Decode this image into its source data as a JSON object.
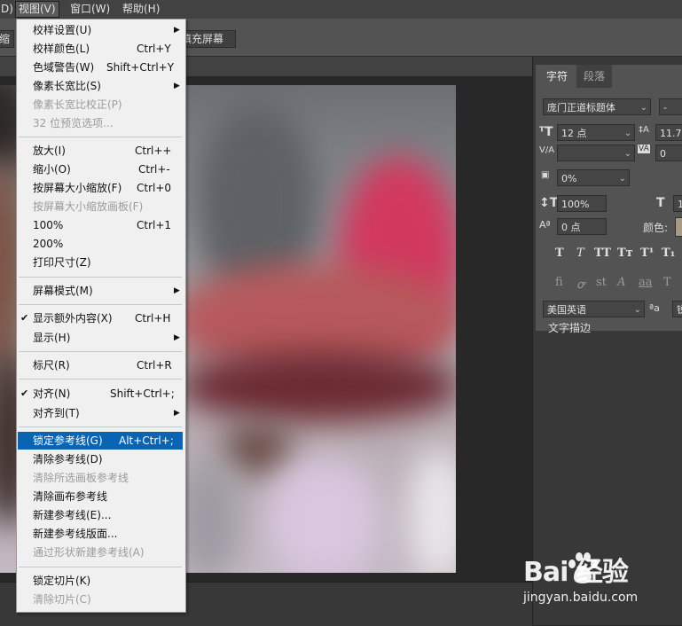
{
  "menubar": {
    "items": [
      {
        "label": "D)"
      },
      {
        "label": "视图(V)"
      },
      {
        "label": "窗口(W)"
      },
      {
        "label": "帮助(H)"
      }
    ]
  },
  "options_bar": {
    "partial_label": "缩",
    "fill_screen": "填充屏幕"
  },
  "view_menu": {
    "items": [
      {
        "label": "校样设置(U)",
        "shortcut": "",
        "submenu": true
      },
      {
        "label": "校样颜色(L)",
        "shortcut": "Ctrl+Y"
      },
      {
        "label": "色域警告(W)",
        "shortcut": "Shift+Ctrl+Y"
      },
      {
        "label": "像素长宽比(S)",
        "shortcut": "",
        "submenu": true
      },
      {
        "label": "像素长宽比校正(P)",
        "shortcut": "",
        "disabled": true
      },
      {
        "label": "32 位预览选项...",
        "shortcut": "",
        "disabled": true
      },
      {
        "label": "放大(I)",
        "shortcut": "Ctrl++"
      },
      {
        "label": "缩小(O)",
        "shortcut": "Ctrl+-"
      },
      {
        "label": "按屏幕大小缩放(F)",
        "shortcut": "Ctrl+0"
      },
      {
        "label": "按屏幕大小缩放画板(F)",
        "shortcut": "",
        "disabled": true
      },
      {
        "label": "100%",
        "shortcut": "Ctrl+1"
      },
      {
        "label": "200%",
        "shortcut": ""
      },
      {
        "label": "打印尺寸(Z)",
        "shortcut": ""
      },
      {
        "label": "屏幕模式(M)",
        "shortcut": "",
        "submenu": true
      },
      {
        "label": "显示额外内容(X)",
        "shortcut": "Ctrl+H",
        "checked": true
      },
      {
        "label": "显示(H)",
        "shortcut": "",
        "submenu": true
      },
      {
        "label": "标尺(R)",
        "shortcut": "Ctrl+R"
      },
      {
        "label": "对齐(N)",
        "shortcut": "Shift+Ctrl+;",
        "checked": true
      },
      {
        "label": "对齐到(T)",
        "shortcut": "",
        "submenu": true
      },
      {
        "label": "锁定参考线(G)",
        "shortcut": "Alt+Ctrl+;",
        "highlighted": true
      },
      {
        "label": "清除参考线(D)",
        "shortcut": ""
      },
      {
        "label": "清除所选画板参考线",
        "shortcut": "",
        "disabled": true
      },
      {
        "label": "清除画布参考线",
        "shortcut": ""
      },
      {
        "label": "新建参考线(E)...",
        "shortcut": ""
      },
      {
        "label": "新建参考线版面...",
        "shortcut": ""
      },
      {
        "label": "通过形状新建参考线(A)",
        "shortcut": "",
        "disabled": true
      },
      {
        "label": "锁定切片(K)",
        "shortcut": ""
      },
      {
        "label": "清除切片(C)",
        "shortcut": "",
        "disabled": true
      }
    ]
  },
  "character_panel": {
    "tabs": [
      {
        "label": "字符"
      },
      {
        "label": "段落"
      }
    ],
    "font_family": "庞门正道标题体",
    "font_style": "-",
    "font_size": "12 点",
    "leading": "11.72",
    "kerning": "",
    "tracking": "0",
    "tsume": "0%",
    "vertical_scale": "100%",
    "horizontal_scale_partial": "1",
    "baseline_shift": "0 点",
    "color_label": "颜色:",
    "style_buttons": [
      "T",
      "T",
      "TT",
      "Tт",
      "T¹",
      "T₁"
    ],
    "opentype_buttons": [
      "fi",
      "ꝍ",
      "st",
      "A",
      "aa",
      "T"
    ],
    "language": "美国英语",
    "aa_label": "ªa",
    "aa_partial": "锐",
    "text_stroke": "文字描边"
  },
  "watermark": {
    "logo_text": "Bai  经验",
    "url": "jingyan.baidu.com"
  }
}
